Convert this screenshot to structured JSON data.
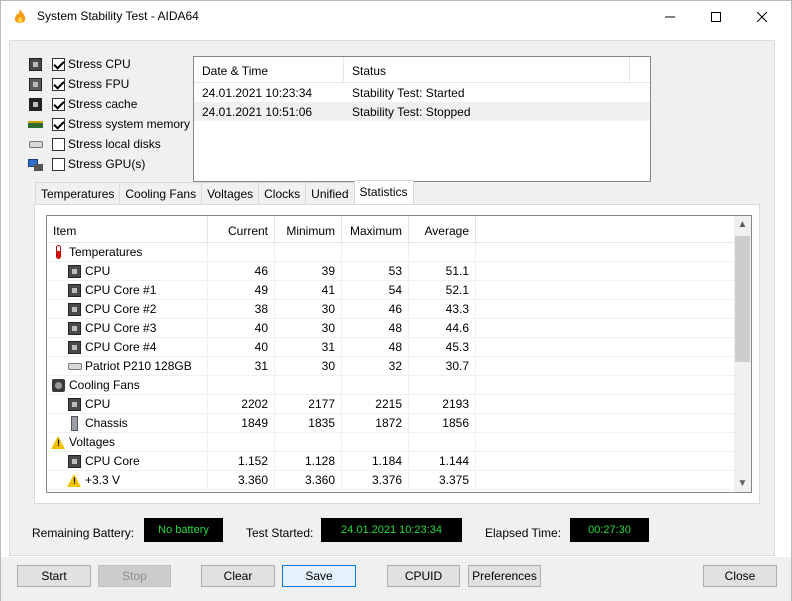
{
  "window": {
    "title": "System Stability Test - AIDA64",
    "minimize": "—",
    "maximize": "☐",
    "close": "✕"
  },
  "stress_options": [
    {
      "label": "Stress CPU",
      "checked": true,
      "icon": "cpu-icon"
    },
    {
      "label": "Stress FPU",
      "checked": true,
      "icon": "fpu-icon"
    },
    {
      "label": "Stress cache",
      "checked": true,
      "icon": "cache-icon"
    },
    {
      "label": "Stress system memory",
      "checked": true,
      "icon": "memory-icon"
    },
    {
      "label": "Stress local disks",
      "checked": false,
      "icon": "disk-icon"
    },
    {
      "label": "Stress GPU(s)",
      "checked": false,
      "icon": "gpu-icon"
    }
  ],
  "log": {
    "headers": [
      "Date & Time",
      "Status"
    ],
    "rows": [
      {
        "datetime": "24.01.2021 10:23:34",
        "status": "Stability Test: Started"
      },
      {
        "datetime": "24.01.2021 10:51:06",
        "status": "Stability Test: Stopped"
      }
    ]
  },
  "tabs": [
    "Temperatures",
    "Cooling Fans",
    "Voltages",
    "Clocks",
    "Unified",
    "Statistics"
  ],
  "active_tab": "Statistics",
  "stats": {
    "headers": [
      "Item",
      "Current",
      "Minimum",
      "Maximum",
      "Average"
    ],
    "rows": [
      {
        "item": "Temperatures",
        "icon": "thermometer-icon",
        "group": true,
        "current": "",
        "minimum": "",
        "maximum": "",
        "average": ""
      },
      {
        "item": "CPU",
        "icon": "cpu-chip-icon",
        "group": false,
        "current": "46",
        "minimum": "39",
        "maximum": "53",
        "average": "51.1"
      },
      {
        "item": "CPU Core #1",
        "icon": "cpu-chip-icon",
        "group": false,
        "current": "49",
        "minimum": "41",
        "maximum": "54",
        "average": "52.1"
      },
      {
        "item": "CPU Core #2",
        "icon": "cpu-chip-icon",
        "group": false,
        "current": "38",
        "minimum": "30",
        "maximum": "46",
        "average": "43.3"
      },
      {
        "item": "CPU Core #3",
        "icon": "cpu-chip-icon",
        "group": false,
        "current": "40",
        "minimum": "30",
        "maximum": "48",
        "average": "44.6"
      },
      {
        "item": "CPU Core #4",
        "icon": "cpu-chip-icon",
        "group": false,
        "current": "40",
        "minimum": "31",
        "maximum": "48",
        "average": "45.3"
      },
      {
        "item": "Patriot P210 128GB",
        "icon": "disk-icon",
        "group": false,
        "current": "31",
        "minimum": "30",
        "maximum": "32",
        "average": "30.7"
      },
      {
        "item": "Cooling Fans",
        "icon": "fan-icon",
        "group": true,
        "current": "",
        "minimum": "",
        "maximum": "",
        "average": ""
      },
      {
        "item": "CPU",
        "icon": "cpu-chip-icon",
        "group": false,
        "current": "2202",
        "minimum": "2177",
        "maximum": "2215",
        "average": "2193"
      },
      {
        "item": "Chassis",
        "icon": "chassis-icon",
        "group": false,
        "current": "1849",
        "minimum": "1835",
        "maximum": "1872",
        "average": "1856"
      },
      {
        "item": "Voltages",
        "icon": "warning-icon",
        "group": true,
        "current": "",
        "minimum": "",
        "maximum": "",
        "average": ""
      },
      {
        "item": "CPU Core",
        "icon": "cpu-chip-icon",
        "group": false,
        "current": "1.152",
        "minimum": "1.128",
        "maximum": "1.184",
        "average": "1.144"
      },
      {
        "item": "+3.3 V",
        "icon": "warning-icon",
        "group": false,
        "current": "3.360",
        "minimum": "3.360",
        "maximum": "3.376",
        "average": "3.375"
      }
    ]
  },
  "status": {
    "battery_label": "Remaining Battery:",
    "battery_value": "No battery",
    "started_label": "Test Started:",
    "started_value": "24.01.2021 10:23:34",
    "elapsed_label": "Elapsed Time:",
    "elapsed_value": "00:27:30"
  },
  "buttons": {
    "start": "Start",
    "stop": "Stop",
    "clear": "Clear",
    "save": "Save",
    "cpuid": "CPUID",
    "preferences": "Preferences",
    "close": "Close"
  },
  "colors": {
    "status_text": "#22d93f",
    "status_bg": "#000000",
    "focus": "#0078d7"
  }
}
